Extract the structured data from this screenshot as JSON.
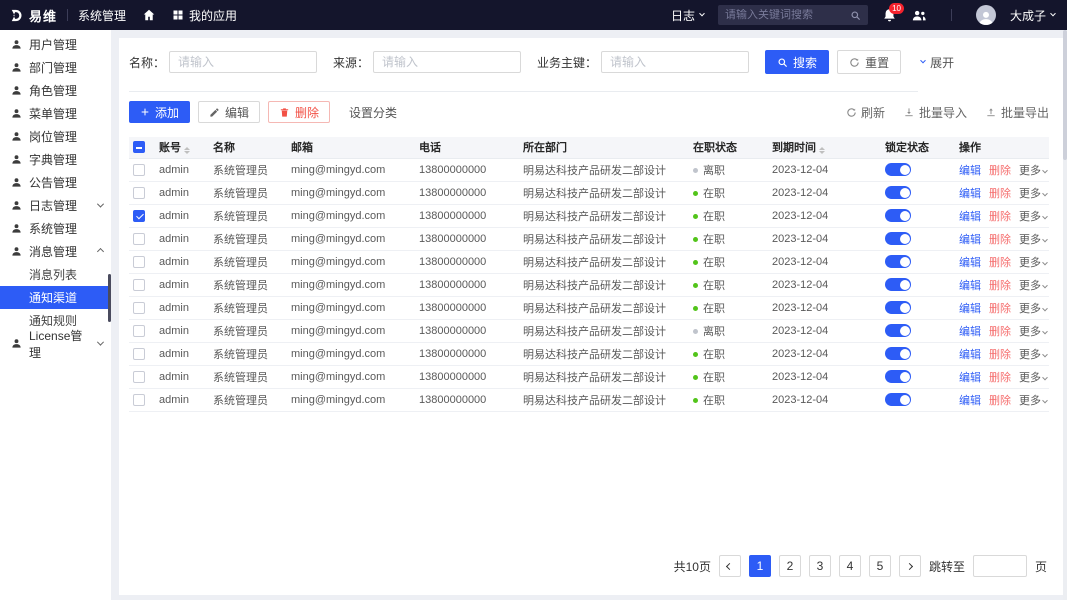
{
  "topbar": {
    "logo_text": "易维",
    "app_title": "系统管理",
    "my_apps_label": "我的应用",
    "log_menu_label": "日志",
    "search_placeholder": "请输入关键词搜索",
    "notification_count": "10",
    "username": "大成子"
  },
  "sidebar": {
    "items": [
      {
        "label": "用户管理"
      },
      {
        "label": "部门管理"
      },
      {
        "label": "角色管理"
      },
      {
        "label": "菜单管理"
      },
      {
        "label": "岗位管理"
      },
      {
        "label": "字典管理"
      },
      {
        "label": "公告管理"
      },
      {
        "label": "日志管理",
        "chevron": "down"
      },
      {
        "label": "系统管理"
      },
      {
        "label": "消息管理",
        "chevron": "up"
      }
    ],
    "submenu_items": [
      {
        "label": "消息列表",
        "active": false
      },
      {
        "label": "通知渠道",
        "active": true
      },
      {
        "label": "通知规则",
        "active": false
      }
    ],
    "bottom_items": [
      {
        "label": "License管理",
        "chevron": "down"
      }
    ]
  },
  "filters": {
    "fields": [
      {
        "label": "名称：",
        "placeholder": "请输入",
        "value": ""
      },
      {
        "label": "来源：",
        "placeholder": "请输入",
        "value": ""
      },
      {
        "label": "业务主键：",
        "placeholder": "请输入",
        "value": ""
      }
    ],
    "search_button": "搜索",
    "reset_button": "重置",
    "expand_button": "展开"
  },
  "toolbar": {
    "add_button": "添加",
    "edit_button": "编辑",
    "delete_button": "删除",
    "set_category_button": "设置分类",
    "refresh_button": "刷新",
    "batch_import_button": "批量导入",
    "batch_export_button": "批量导出"
  },
  "table": {
    "headers": [
      {
        "label": "账号",
        "sortable": true
      },
      {
        "label": "名称",
        "sortable": false
      },
      {
        "label": "邮箱",
        "sortable": false
      },
      {
        "label": "电话",
        "sortable": false
      },
      {
        "label": "所在部门",
        "sortable": false
      },
      {
        "label": "在职状态",
        "sortable": false
      },
      {
        "label": "到期时间",
        "sortable": true
      },
      {
        "label": "锁定状态",
        "sortable": false
      },
      {
        "label": "操作",
        "sortable": false
      }
    ],
    "rows": [
      {
        "account": "admin",
        "name": "系统管理员",
        "email": "ming@mingyd.com",
        "phone": "13800000000",
        "dept": "明易达科技产品研发二部设计",
        "status": "离职",
        "status_on": false,
        "expiry": "2023-12-04",
        "locked": true,
        "checked": false
      },
      {
        "account": "admin",
        "name": "系统管理员",
        "email": "ming@mingyd.com",
        "phone": "13800000000",
        "dept": "明易达科技产品研发二部设计",
        "status": "在职",
        "status_on": true,
        "expiry": "2023-12-04",
        "locked": true,
        "checked": false
      },
      {
        "account": "admin",
        "name": "系统管理员",
        "email": "ming@mingyd.com",
        "phone": "13800000000",
        "dept": "明易达科技产品研发二部设计",
        "status": "在职",
        "status_on": true,
        "expiry": "2023-12-04",
        "locked": true,
        "checked": true
      },
      {
        "account": "admin",
        "name": "系统管理员",
        "email": "ming@mingyd.com",
        "phone": "13800000000",
        "dept": "明易达科技产品研发二部设计",
        "status": "在职",
        "status_on": true,
        "expiry": "2023-12-04",
        "locked": true,
        "checked": false
      },
      {
        "account": "admin",
        "name": "系统管理员",
        "email": "ming@mingyd.com",
        "phone": "13800000000",
        "dept": "明易达科技产品研发二部设计",
        "status": "在职",
        "status_on": true,
        "expiry": "2023-12-04",
        "locked": true,
        "checked": false
      },
      {
        "account": "admin",
        "name": "系统管理员",
        "email": "ming@mingyd.com",
        "phone": "13800000000",
        "dept": "明易达科技产品研发二部设计",
        "status": "在职",
        "status_on": true,
        "expiry": "2023-12-04",
        "locked": true,
        "checked": false
      },
      {
        "account": "admin",
        "name": "系统管理员",
        "email": "ming@mingyd.com",
        "phone": "13800000000",
        "dept": "明易达科技产品研发二部设计",
        "status": "在职",
        "status_on": true,
        "expiry": "2023-12-04",
        "locked": true,
        "checked": false
      },
      {
        "account": "admin",
        "name": "系统管理员",
        "email": "ming@mingyd.com",
        "phone": "13800000000",
        "dept": "明易达科技产品研发二部设计",
        "status": "离职",
        "status_on": false,
        "expiry": "2023-12-04",
        "locked": true,
        "checked": false
      },
      {
        "account": "admin",
        "name": "系统管理员",
        "email": "ming@mingyd.com",
        "phone": "13800000000",
        "dept": "明易达科技产品研发二部设计",
        "status": "在职",
        "status_on": true,
        "expiry": "2023-12-04",
        "locked": true,
        "checked": false
      },
      {
        "account": "admin",
        "name": "系统管理员",
        "email": "ming@mingyd.com",
        "phone": "13800000000",
        "dept": "明易达科技产品研发二部设计",
        "status": "在职",
        "status_on": true,
        "expiry": "2023-12-04",
        "locked": true,
        "checked": false
      },
      {
        "account": "admin",
        "name": "系统管理员",
        "email": "ming@mingyd.com",
        "phone": "13800000000",
        "dept": "明易达科技产品研发二部设计",
        "status": "在职",
        "status_on": true,
        "expiry": "2023-12-04",
        "locked": true,
        "checked": false
      }
    ],
    "actions": {
      "edit": "编辑",
      "delete": "删除",
      "more": "更多"
    }
  },
  "pagination": {
    "total_label": "共10页",
    "pages": [
      "1",
      "2",
      "3",
      "4",
      "5"
    ],
    "active_page": "1",
    "jump_label": "跳转至",
    "jump_suffix": "页",
    "jump_value": ""
  }
}
